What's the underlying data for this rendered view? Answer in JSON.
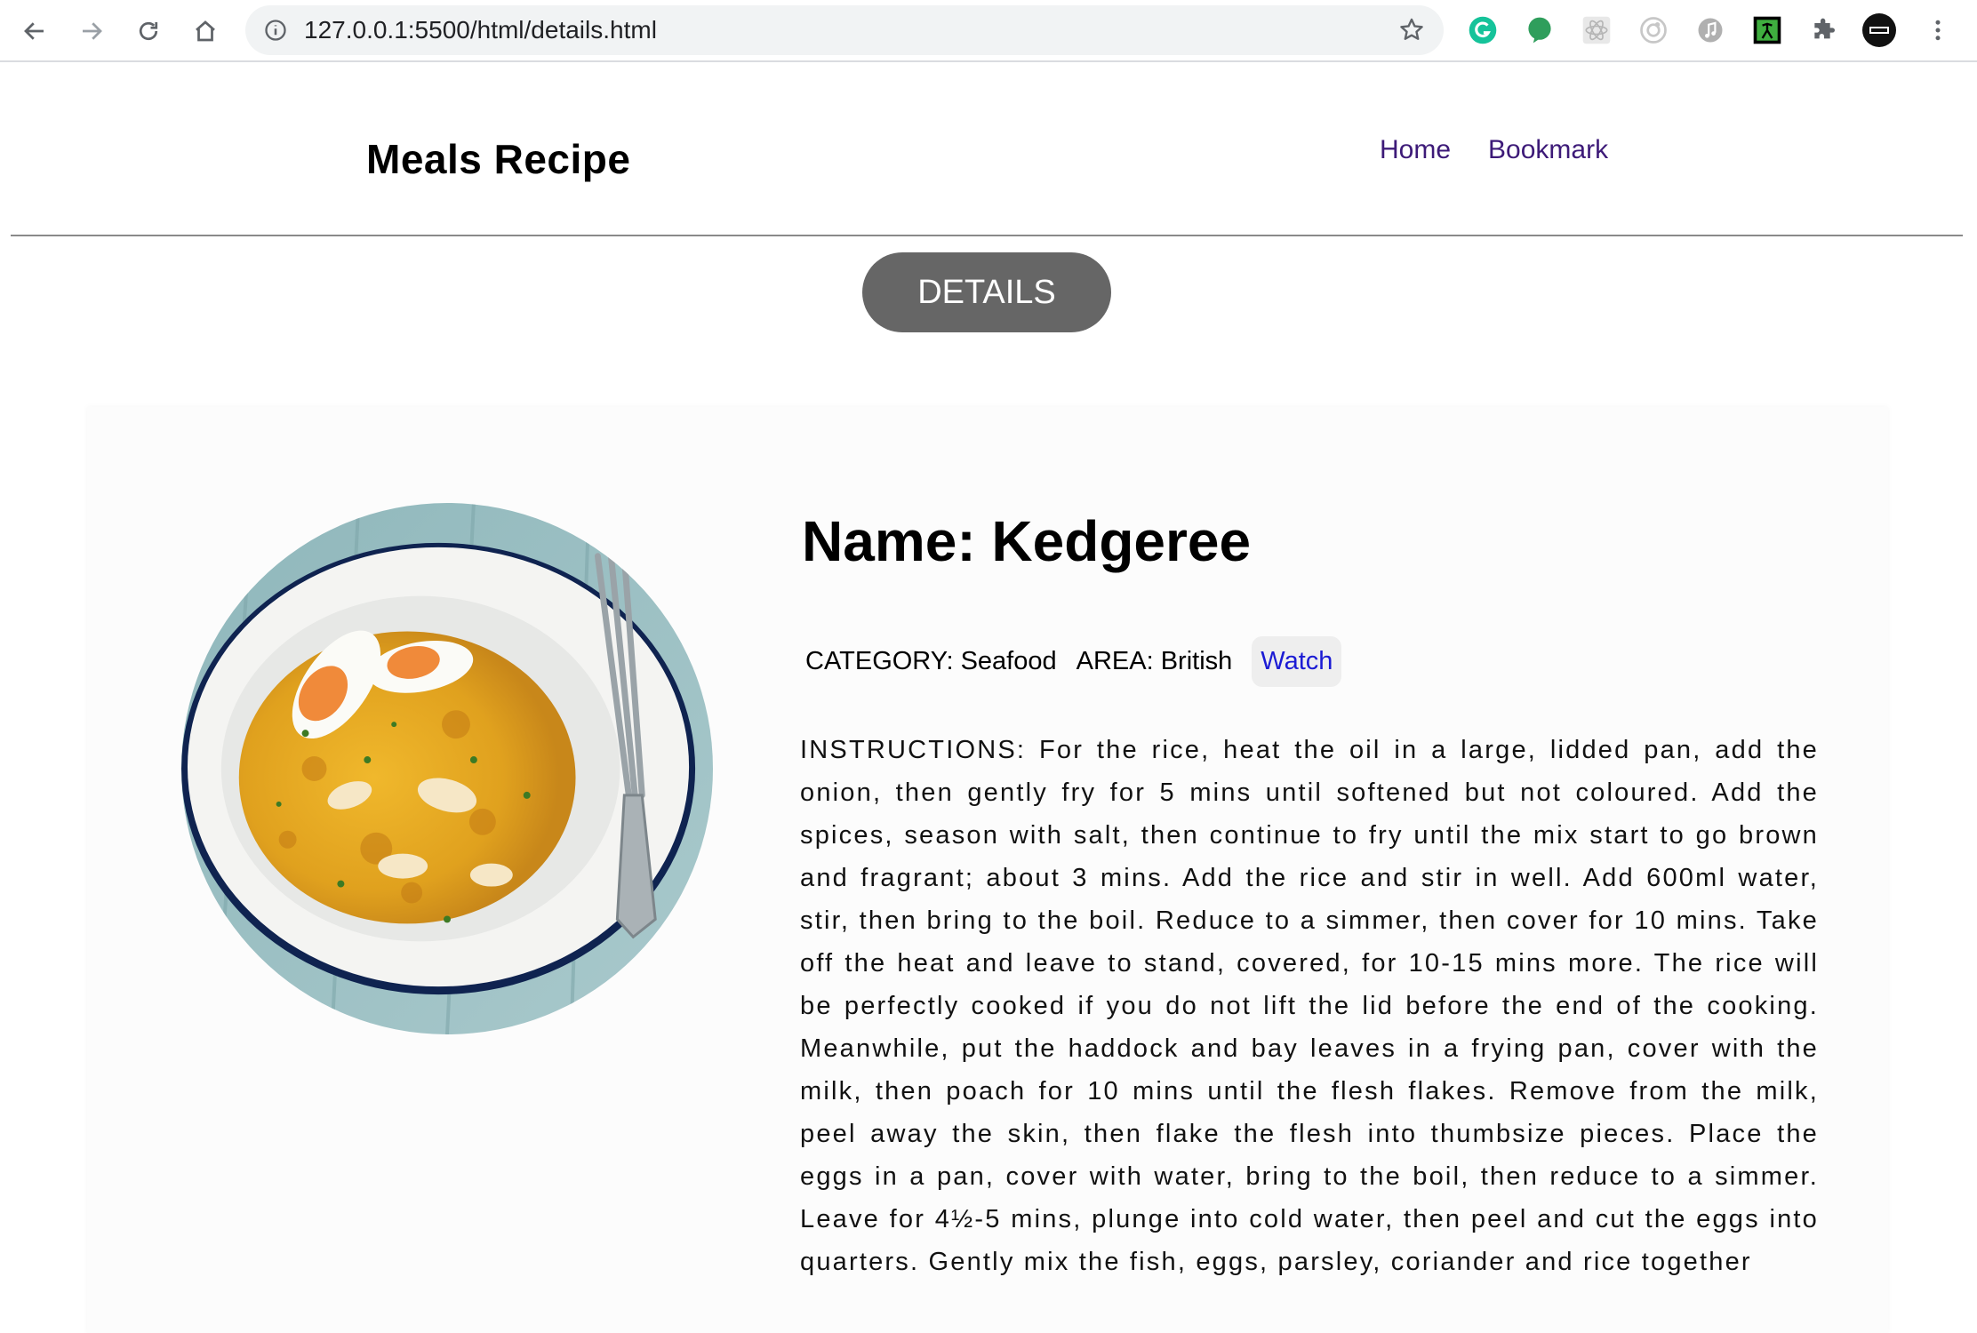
{
  "browser": {
    "url": "127.0.0.1:5500/html/details.html"
  },
  "header": {
    "logo": "Meals Recipe",
    "nav": [
      "Home",
      "Bookmark"
    ]
  },
  "details_badge": "DETAILS",
  "meal": {
    "title": "Name: Kedgeree",
    "category": "CATEGORY: Seafood",
    "area": "AREA: British",
    "watch_label": "Watch",
    "instructions": "INSTRUCTIONS: For the rice, heat the oil in a large, lidded pan, add the onion, then gently fry for 5 mins until softened but not coloured. Add the spices, season with salt, then continue to fry until the mix start to go brown and fragrant; about 3 mins. Add the rice and stir in well. Add 600ml water, stir, then bring to the boil. Reduce to a simmer, then cover for 10 mins. Take off the heat and leave to stand, covered, for 10-15 mins more. The rice will be perfectly cooked if you do not lift the lid before the end of the cooking. Meanwhile, put the haddock and bay leaves in a frying pan, cover with the milk, then poach for 10 mins until the flesh flakes. Remove from the milk, peel away the skin, then flake the flesh into thumbsize pieces. Place the eggs in a pan, cover with water, bring to the boil, then reduce to a simmer. Leave for 4½-5 mins, plunge into cold water, then peel and cut the eggs into quarters. Gently mix the fish, eggs, parsley, coriander and rice together"
  },
  "colors": {
    "nav_link": "#3d1a78",
    "badge_bg": "#666666",
    "watch_link": "#1b1bd4"
  }
}
